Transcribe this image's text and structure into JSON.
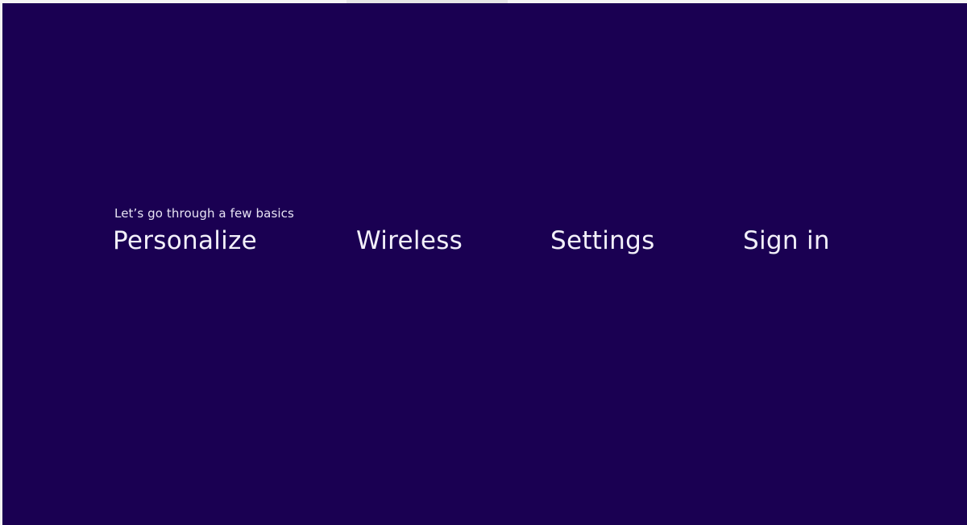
{
  "setup": {
    "subtitle": "Let’s go through a few basics",
    "steps": [
      {
        "label": "Personalize"
      },
      {
        "label": "Wireless"
      },
      {
        "label": "Settings"
      },
      {
        "label": "Sign in"
      }
    ]
  },
  "colors": {
    "background": "#1a0052",
    "text": "#f3f0fa"
  }
}
